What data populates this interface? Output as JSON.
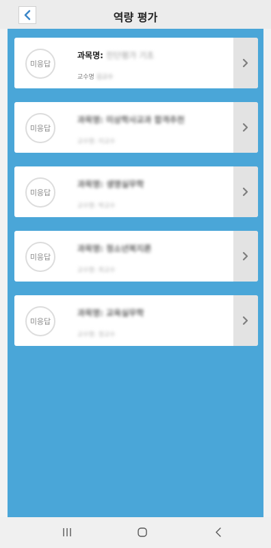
{
  "header": {
    "title": "역량 평가",
    "back_icon": "chevron-left-icon"
  },
  "colors": {
    "accent": "#4aa6d8",
    "card_bg": "#ffffff",
    "chevron_bg": "#e3e3e3",
    "badge_border": "#dcdcdc"
  },
  "courses": [
    {
      "status": "미응답",
      "course_label": "과목명:",
      "course_name": "진단평가 기초",
      "prof_label": "교수명",
      "prof_name": "김교수"
    },
    {
      "status": "미응답",
      "course_label": "과목명:",
      "course_name": "미상학사교과 합격추천",
      "prof_label": "교수명:",
      "prof_name": "이교수"
    },
    {
      "status": "미응답",
      "course_label": "과목명:",
      "course_name": "생명실무학",
      "prof_label": "교수명:",
      "prof_name": "박교수"
    },
    {
      "status": "미응답",
      "course_label": "과목명:",
      "course_name": "청소년복지론",
      "prof_label": "교수명:",
      "prof_name": "최교수"
    },
    {
      "status": "미응답",
      "course_label": "과목명:",
      "course_name": "교육실무학",
      "prof_label": "교수명:",
      "prof_name": "정교수"
    }
  ],
  "navbar": {
    "recent_icon": "recent-apps-icon",
    "home_icon": "home-icon",
    "back_icon": "back-icon"
  }
}
